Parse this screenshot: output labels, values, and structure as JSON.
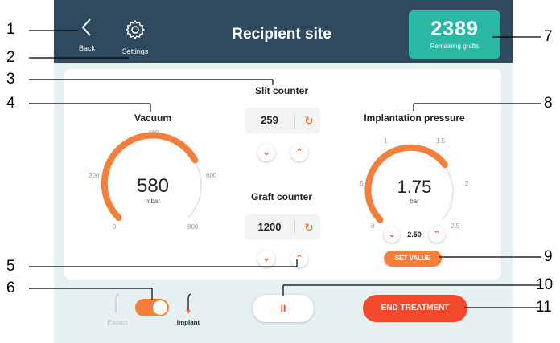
{
  "header": {
    "back_label": "Back",
    "settings_label": "Settings",
    "title": "Recipient site",
    "remaining_count": "2389",
    "remaining_label": "Remaining grafts"
  },
  "vacuum": {
    "title": "Vacuum",
    "value": "580",
    "unit": "mbar",
    "ticks": [
      "400",
      "200",
      "600",
      "0",
      "800"
    ],
    "max": 800,
    "level": 580
  },
  "slit_counter": {
    "title": "Slit counter",
    "value": "259"
  },
  "graft_counter": {
    "title": "Graft counter",
    "value": "1200"
  },
  "implantation": {
    "title": "Implantation pressure",
    "value": "1.75",
    "unit": "bar",
    "ticks": [
      "1",
      "1.5",
      ".5",
      "2",
      "0",
      "2.5"
    ],
    "setpoint": "2.50",
    "set_label": "SET VALUE",
    "max": 2.5,
    "level": 1.75
  },
  "bottom": {
    "extract_label": "Extract",
    "implant_label": "Implant",
    "pause_symbol": "II",
    "end_label": "END TREATMENT"
  },
  "callouts": [
    "1",
    "2",
    "3",
    "4",
    "5",
    "6",
    "7",
    "8",
    "9",
    "10",
    "11"
  ],
  "colors": {
    "accent": "#f37f3a",
    "header": "#2f4a5e",
    "teal": "#2ab7a3",
    "danger": "#f2492c"
  }
}
